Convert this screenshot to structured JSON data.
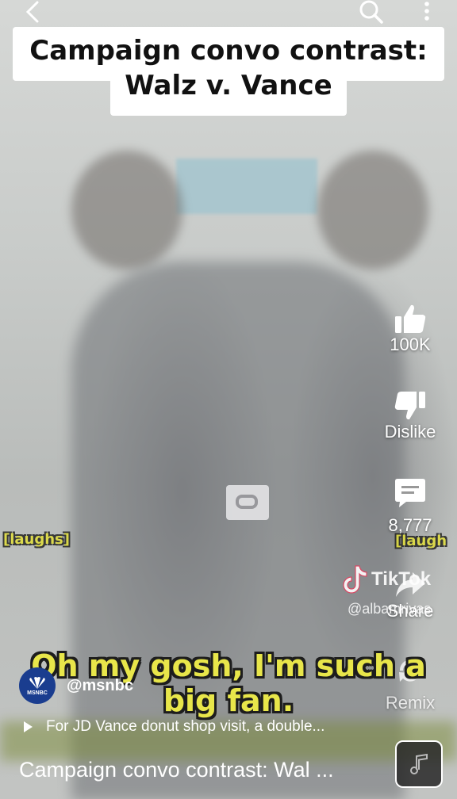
{
  "video": {
    "title_overlay": "Campaign convo contrast: Walz v. Vance",
    "subtitle": "Oh my gosh, I'm such a big fan.",
    "caption_left": "[laughs]",
    "caption_right": "[laugh"
  },
  "watermark": {
    "brand": "TikTok",
    "handle": "@albamrivas"
  },
  "actions": {
    "like_count": "100K",
    "dislike_label": "Dislike",
    "comment_count": "8,777",
    "share_label": "Share",
    "remix_label": "Remix"
  },
  "channel": {
    "handle": "@msnbc",
    "logo_text": "MSNBC"
  },
  "related": {
    "text": "For JD Vance donut shop visit, a double..."
  },
  "bottom": {
    "title": "Campaign convo contrast: Wal ..."
  },
  "icons": [
    "back-icon",
    "search-icon",
    "more-icon",
    "like-icon",
    "dislike-icon",
    "comment-icon",
    "share-icon",
    "remix-icon",
    "play-icon",
    "music-icon"
  ],
  "colors": {
    "subtitle_yellow": "#e8e64a",
    "text": "#ffffff"
  }
}
